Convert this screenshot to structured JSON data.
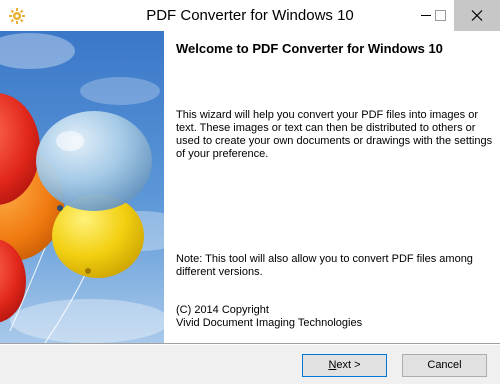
{
  "window": {
    "title": "PDF Converter for Windows 10",
    "icons": {
      "app": "app-icon",
      "minimize": "minimize-icon",
      "maximize": "maximize-icon",
      "close": "close-icon"
    }
  },
  "wizard": {
    "heading": "Welcome to PDF Converter for Windows 10",
    "intro": "This wizard will help you convert your PDF files into images or text. These images or text can then be distributed to others or used to create your own documents or drawings with the settings of your preference.",
    "note": "Note: This tool will also allow you to convert PDF files among different versions.",
    "copyright": "(C) 2014 Copyright",
    "company": "Vivid Document Imaging Technologies",
    "side_image": "balloons-image"
  },
  "buttons": {
    "next_mnemonic": "N",
    "next_rest": "ext >",
    "cancel": "Cancel"
  },
  "colors": {
    "title_bg": "#ffffff",
    "content_bg": "#ffffff",
    "footer_bg": "#f0f0f0",
    "focus_border": "#0078d7"
  }
}
